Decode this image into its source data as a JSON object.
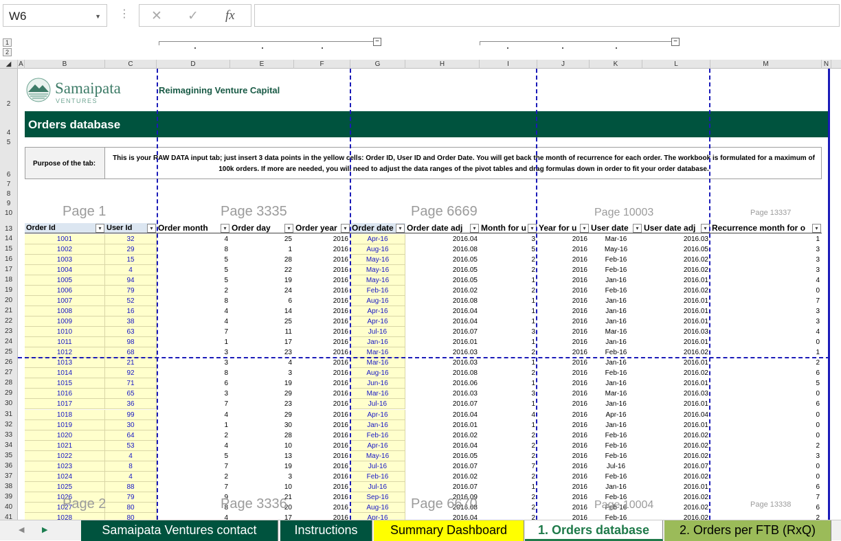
{
  "formula_bar": {
    "name_box": "W6",
    "formula": "",
    "fx_label": "fx"
  },
  "outline": {
    "levels": [
      "1",
      "2"
    ]
  },
  "columns": [
    "A",
    "B",
    "C",
    "D",
    "E",
    "F",
    "G",
    "H",
    "I",
    "J",
    "K",
    "L",
    "M",
    "N"
  ],
  "rows_top": [
    "2",
    "4",
    "5",
    "6",
    "7",
    "8",
    "9",
    "10",
    "13"
  ],
  "rows_data": [
    "14",
    "15",
    "16",
    "17",
    "18",
    "19",
    "20",
    "21",
    "22",
    "23",
    "24",
    "25",
    "26",
    "27",
    "28",
    "29",
    "30",
    "31",
    "32",
    "33",
    "34",
    "35",
    "36",
    "37",
    "38",
    "39",
    "40",
    "41"
  ],
  "sheet": {
    "logo_name": "Samaipata",
    "logo_sub": "VENTURES",
    "tagline": "Reimagining Venture Capital",
    "title": "Orders database",
    "purpose_label": "Purpose of the tab:",
    "purpose_text": "This is your RAW DATA input tab; just insert 3 data points in the yellow cells: Order ID, User ID and Order Date. You will get back the month of recurrence for each order. The workbook is formulated for a maximum of 100k orders. If more are needed, you will need to adjust the data ranges of the pivot tables and drag formulas down in order to fit your order database."
  },
  "page_labels": {
    "p1": "Page 1",
    "p3335": "Page 3335",
    "p6669": "Page 6669",
    "p10003": "Page 10003",
    "p13337": "Page 13337",
    "p2": "Page 2",
    "p3336": "Page 3336",
    "p6670": "Page 6670",
    "p10004": "Page 10004",
    "p13338": "Page 13338"
  },
  "table": {
    "headers": [
      "Order Id",
      "User Id",
      "Order month",
      "Order day",
      "Order year",
      "Order date",
      "Order date adj",
      "Month for u",
      "Year for u",
      "User date",
      "User date adj",
      "Recurrence month for o"
    ],
    "rows": [
      [
        "1001",
        "32",
        "4",
        "25",
        "2016",
        "Apr-16",
        "2016.04",
        "3",
        "2016",
        "Mar-16",
        "2016.03",
        "1"
      ],
      [
        "1002",
        "29",
        "8",
        "1",
        "2016",
        "Aug-16",
        "2016.08",
        "5",
        "2016",
        "May-16",
        "2016.05",
        "3"
      ],
      [
        "1003",
        "15",
        "5",
        "28",
        "2016",
        "May-16",
        "2016.05",
        "2",
        "2016",
        "Feb-16",
        "2016.02",
        "3"
      ],
      [
        "1004",
        "4",
        "5",
        "22",
        "2016",
        "May-16",
        "2016.05",
        "2",
        "2016",
        "Feb-16",
        "2016.02",
        "3"
      ],
      [
        "1005",
        "94",
        "5",
        "19",
        "2016",
        "May-16",
        "2016.05",
        "1",
        "2016",
        "Jan-16",
        "2016.01",
        "4"
      ],
      [
        "1006",
        "79",
        "2",
        "24",
        "2016",
        "Feb-16",
        "2016.02",
        "2",
        "2016",
        "Feb-16",
        "2016.02",
        "0"
      ],
      [
        "1007",
        "52",
        "8",
        "6",
        "2016",
        "Aug-16",
        "2016.08",
        "1",
        "2016",
        "Jan-16",
        "2016.01",
        "7"
      ],
      [
        "1008",
        "16",
        "4",
        "14",
        "2016",
        "Apr-16",
        "2016.04",
        "1",
        "2016",
        "Jan-16",
        "2016.01",
        "3"
      ],
      [
        "1009",
        "38",
        "4",
        "25",
        "2016",
        "Apr-16",
        "2016.04",
        "1",
        "2016",
        "Jan-16",
        "2016.01",
        "3"
      ],
      [
        "1010",
        "63",
        "7",
        "11",
        "2016",
        "Jul-16",
        "2016.07",
        "3",
        "2016",
        "Mar-16",
        "2016.03",
        "4"
      ],
      [
        "1011",
        "98",
        "1",
        "17",
        "2016",
        "Jan-16",
        "2016.01",
        "1",
        "2016",
        "Jan-16",
        "2016.01",
        "0"
      ],
      [
        "1012",
        "68",
        "3",
        "23",
        "2016",
        "Mar-16",
        "2016.03",
        "2",
        "2016",
        "Feb-16",
        "2016.02",
        "1"
      ],
      [
        "1013",
        "21",
        "3",
        "4",
        "2016",
        "Mar-16",
        "2016.03",
        "1",
        "2016",
        "Jan-16",
        "2016.01",
        "2"
      ],
      [
        "1014",
        "92",
        "8",
        "3",
        "2016",
        "Aug-16",
        "2016.08",
        "2",
        "2016",
        "Feb-16",
        "2016.02",
        "6"
      ],
      [
        "1015",
        "71",
        "6",
        "19",
        "2016",
        "Jun-16",
        "2016.06",
        "1",
        "2016",
        "Jan-16",
        "2016.01",
        "5"
      ],
      [
        "1016",
        "65",
        "3",
        "29",
        "2016",
        "Mar-16",
        "2016.03",
        "3",
        "2016",
        "Mar-16",
        "2016.03",
        "0"
      ],
      [
        "1017",
        "36",
        "7",
        "23",
        "2016",
        "Jul-16",
        "2016.07",
        "1",
        "2016",
        "Jan-16",
        "2016.01",
        "6"
      ],
      [
        "1018",
        "99",
        "4",
        "29",
        "2016",
        "Apr-16",
        "2016.04",
        "4",
        "2016",
        "Apr-16",
        "2016.04",
        "0"
      ],
      [
        "1019",
        "30",
        "1",
        "30",
        "2016",
        "Jan-16",
        "2016.01",
        "1",
        "2016",
        "Jan-16",
        "2016.01",
        "0"
      ],
      [
        "1020",
        "64",
        "2",
        "28",
        "2016",
        "Feb-16",
        "2016.02",
        "2",
        "2016",
        "Feb-16",
        "2016.02",
        "0"
      ],
      [
        "1021",
        "53",
        "4",
        "10",
        "2016",
        "Apr-16",
        "2016.04",
        "2",
        "2016",
        "Feb-16",
        "2016.02",
        "2"
      ],
      [
        "1022",
        "4",
        "5",
        "13",
        "2016",
        "May-16",
        "2016.05",
        "2",
        "2016",
        "Feb-16",
        "2016.02",
        "3"
      ],
      [
        "1023",
        "8",
        "7",
        "19",
        "2016",
        "Jul-16",
        "2016.07",
        "7",
        "2016",
        "Jul-16",
        "2016.07",
        "0"
      ],
      [
        "1024",
        "4",
        "2",
        "3",
        "2016",
        "Feb-16",
        "2016.02",
        "2",
        "2016",
        "Feb-16",
        "2016.02",
        "0"
      ],
      [
        "1025",
        "88",
        "7",
        "10",
        "2016",
        "Jul-16",
        "2016.07",
        "1",
        "2016",
        "Jan-16",
        "2016.01",
        "6"
      ],
      [
        "1026",
        "79",
        "9",
        "21",
        "2016",
        "Sep-16",
        "2016.09",
        "2",
        "2016",
        "Feb-16",
        "2016.02",
        "7"
      ],
      [
        "1027",
        "80",
        "8",
        "20",
        "2016",
        "Aug-16",
        "2016.08",
        "2",
        "2016",
        "Feb-16",
        "2016.02",
        "6"
      ],
      [
        "1028",
        "80",
        "4",
        "17",
        "2016",
        "Apr-16",
        "2016.04",
        "2",
        "2016",
        "Feb-16",
        "2016.02",
        "2"
      ]
    ]
  },
  "tabs": [
    {
      "label": "Samaipata Ventures contact",
      "bg": "#00533e",
      "fg": "#ffffff"
    },
    {
      "label": "Instructions",
      "bg": "#00533e",
      "fg": "#ffffff"
    },
    {
      "label": "Summary Dashboard",
      "bg": "#ffff00",
      "fg": "#000000"
    },
    {
      "label": "1. Orders database",
      "bg": "#ffffff",
      "fg": "#1f7a4a",
      "active": true
    },
    {
      "label": "2. Orders per FTB (RxQ)",
      "bg": "#9bbb59",
      "fg": "#000000"
    }
  ]
}
